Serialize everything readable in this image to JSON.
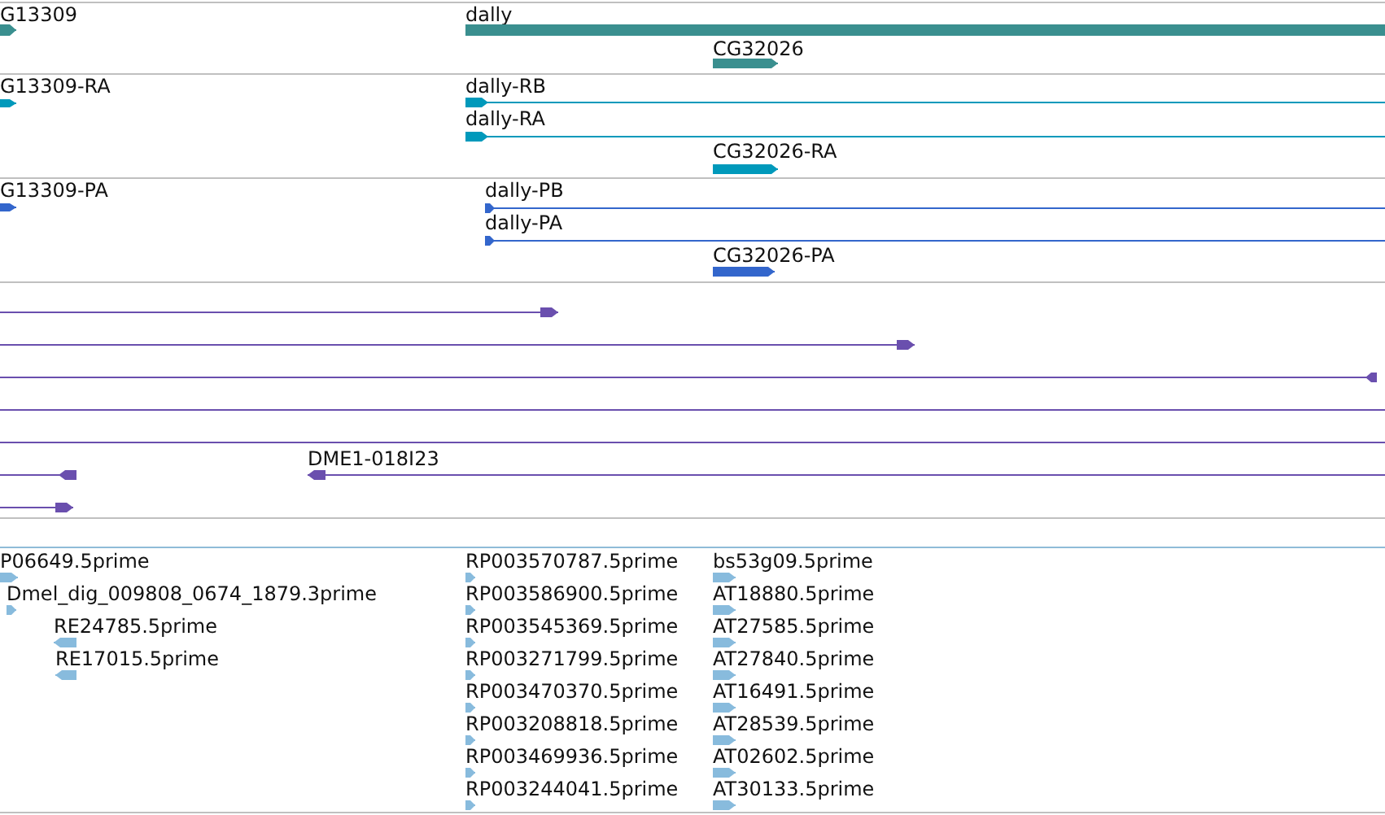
{
  "tracks": [
    {
      "color": "#3a8f8f",
      "features": [
        {
          "label": "G13309",
          "kind": "forward"
        },
        {
          "label": "dally",
          "kind": "plain"
        },
        {
          "label": "CG32026",
          "kind": "forward"
        }
      ]
    },
    {
      "color": "#0099bb",
      "features": [
        {
          "label": "G13309-RA",
          "kind": "forward"
        },
        {
          "label": "dally-RB",
          "kind": "forward"
        },
        {
          "label": "dally-RA",
          "kind": "forward"
        },
        {
          "label": "CG32026-RA",
          "kind": "forward"
        }
      ]
    },
    {
      "color": "#3366cc",
      "features": [
        {
          "label": "G13309-PA",
          "kind": "forward"
        },
        {
          "label": "dally-PB",
          "kind": "forward"
        },
        {
          "label": "dally-PA",
          "kind": "forward"
        },
        {
          "label": "CG32026-PA",
          "kind": "forward"
        }
      ]
    },
    {
      "color": "#6a4fae",
      "features": [
        {
          "kind": "forward"
        },
        {
          "kind": "forward"
        },
        {
          "kind": "reverse"
        },
        {
          "kind": "plain"
        },
        {
          "kind": "plain"
        },
        {
          "kind": "reverse"
        },
        {
          "label": "DME1-018I23",
          "kind": "reverse"
        },
        {
          "kind": "forward"
        }
      ]
    },
    {
      "color": "#88bbdd",
      "features": [
        {
          "label": "P06649.5prime",
          "kind": "forward"
        },
        {
          "label": "Dmel_dig_009808_0674_1879.3prime",
          "kind": "forward"
        },
        {
          "label": "RE24785.5prime",
          "kind": "reverse"
        },
        {
          "label": "RE17015.5prime",
          "kind": "reverse"
        },
        {
          "label": "RP003570787.5prime",
          "kind": "forward"
        },
        {
          "label": "RP003586900.5prime",
          "kind": "forward"
        },
        {
          "label": "RP003545369.5prime",
          "kind": "forward"
        },
        {
          "label": "RP003271799.5prime",
          "kind": "forward"
        },
        {
          "label": "RP003470370.5prime",
          "kind": "forward"
        },
        {
          "label": "RP003208818.5prime",
          "kind": "forward"
        },
        {
          "label": "RP003469936.5prime",
          "kind": "forward"
        },
        {
          "label": "RP003244041.5prime",
          "kind": "forward"
        },
        {
          "label": "bs53g09.5prime",
          "kind": "forward"
        },
        {
          "label": "AT18880.5prime",
          "kind": "forward"
        },
        {
          "label": "AT27585.5prime",
          "kind": "forward"
        },
        {
          "label": "AT27840.5prime",
          "kind": "forward"
        },
        {
          "label": "AT16491.5prime",
          "kind": "forward"
        },
        {
          "label": "AT28539.5prime",
          "kind": "forward"
        },
        {
          "label": "AT02602.5prime",
          "kind": "forward"
        },
        {
          "label": "AT30133.5prime",
          "kind": "forward"
        }
      ]
    }
  ]
}
